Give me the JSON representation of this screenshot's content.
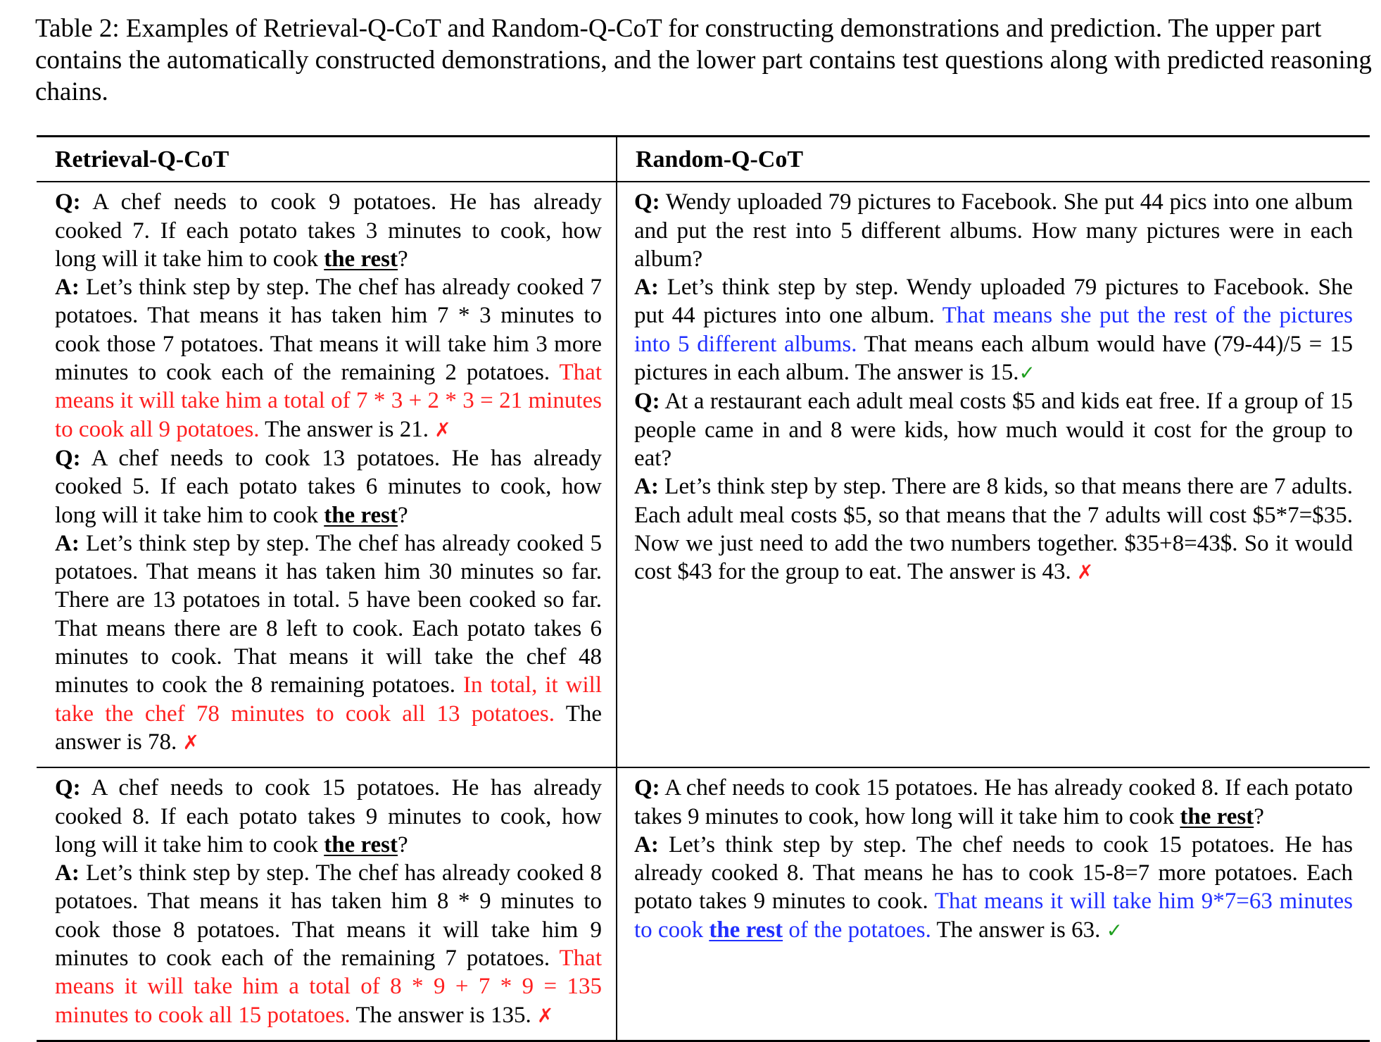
{
  "caption": "Table 2: Examples of Retrieval-Q-CoT and Random-Q-CoT for constructing demonstrations and prediction. The upper part contains the automatically constructed demonstrations, and the lower part contains test questions along with predicted reasoning chains.",
  "headers": {
    "left": "Retrieval-Q-CoT",
    "right": "Random-Q-CoT"
  },
  "colors": {
    "red": "#ff1f1f",
    "blue": "#1f2fff",
    "green": "#1f9f1f"
  },
  "rows": {
    "demo_left": [
      {
        "t": "Q:",
        "s": "q"
      },
      {
        "t": " A chef needs to cook 9 potatoes. He has already cooked 7. If each potato takes 3 minutes to cook, how long will it take him to cook ",
        "s": "n"
      },
      {
        "t": "the rest",
        "s": "ul"
      },
      {
        "t": "?",
        "s": "n"
      },
      {
        "t": "",
        "s": "br"
      },
      {
        "t": "A:",
        "s": "a"
      },
      {
        "t": " Let’s think step by step. The chef has already cooked 7 potatoes. That means it has taken him 7 * 3 minutes to cook those 7 potatoes. That means it will take him 3 more minutes to cook each of the remaining 2 potatoes. ",
        "s": "n"
      },
      {
        "t": "That means it will take him a total of 7 * 3 + 2 * 3 = 21 minutes to cook all 9 potatoes.",
        "s": "red"
      },
      {
        "t": " The answer is 21. ",
        "s": "n"
      },
      {
        "t": "✗",
        "s": "x"
      },
      {
        "t": "",
        "s": "br"
      },
      {
        "t": "Q:",
        "s": "q"
      },
      {
        "t": " A chef needs to cook 13 potatoes. He has already cooked 5. If each potato takes 6 minutes to cook, how long will it take him to cook ",
        "s": "n"
      },
      {
        "t": "the rest",
        "s": "ul"
      },
      {
        "t": "?",
        "s": "n"
      },
      {
        "t": "",
        "s": "br"
      },
      {
        "t": "A:",
        "s": "a"
      },
      {
        "t": " Let’s think step by step. The chef has already cooked 5 potatoes. That means it has taken him 30 minutes so far. There are 13 potatoes in total. 5 have been cooked so far. That means there are 8 left to cook. Each potato takes 6 minutes to cook. That means it will take the chef 48 minutes to cook the 8 remaining potatoes. ",
        "s": "n"
      },
      {
        "t": "In total, it will take the chef 78 minutes to cook all 13 potatoes.",
        "s": "red"
      },
      {
        "t": " The answer is 78. ",
        "s": "n"
      },
      {
        "t": "✗",
        "s": "x"
      }
    ],
    "demo_right": [
      {
        "t": "Q:",
        "s": "q"
      },
      {
        "t": " Wendy uploaded 79 pictures to Facebook. She put 44 pics into one album and put the rest into 5 different albums. How many pictures were in each album?",
        "s": "n"
      },
      {
        "t": "",
        "s": "br"
      },
      {
        "t": "A:",
        "s": "a"
      },
      {
        "t": " Let’s think step by step. Wendy uploaded 79 pictures to Facebook. She put 44 pictures into one album. ",
        "s": "n"
      },
      {
        "t": "That means she put the rest of the pictures into 5 different albums.",
        "s": "blue"
      },
      {
        "t": " That means each album would have (79-44)/5 = 15 pictures in each album. The answer is 15.",
        "s": "n"
      },
      {
        "t": "✓",
        "s": "check"
      },
      {
        "t": "",
        "s": "br"
      },
      {
        "t": "Q:",
        "s": "q"
      },
      {
        "t": " At a restaurant each adult meal costs $5 and kids eat free. If a group of 15 people came in and 8 were kids, how much would it cost for the group to eat?",
        "s": "n"
      },
      {
        "t": "",
        "s": "br"
      },
      {
        "t": "A:",
        "s": "a"
      },
      {
        "t": " Let’s think step by step. There are 8 kids, so that means there are 7 adults. Each adult meal costs $5, so that means that the 7 adults will cost $5*7=$35. Now we just need to add the two numbers together. $35+8=43$. So it would cost $43 for the group to eat. The answer is 43. ",
        "s": "n"
      },
      {
        "t": "✗",
        "s": "x"
      }
    ],
    "test_left": [
      {
        "t": "Q:",
        "s": "q"
      },
      {
        "t": " A chef needs to cook 15 potatoes. He has already cooked 8. If each potato takes 9 minutes to cook, how long will it take him to cook ",
        "s": "n"
      },
      {
        "t": "the rest",
        "s": "ul"
      },
      {
        "t": "?",
        "s": "n"
      },
      {
        "t": "",
        "s": "br"
      },
      {
        "t": "A:",
        "s": "a"
      },
      {
        "t": " Let’s think step by step. The chef has already cooked 8 potatoes. That means it has taken him 8 * 9 minutes to cook those 8 potatoes. That means it will take him 9 minutes to cook each of the remaining 7 potatoes. ",
        "s": "n"
      },
      {
        "t": "That means it will take him a total of 8 * 9 + 7 * 9 = 135 minutes to cook all 15 potatoes.",
        "s": "red"
      },
      {
        "t": " The answer is 135. ",
        "s": "n"
      },
      {
        "t": "✗",
        "s": "x"
      }
    ],
    "test_right": [
      {
        "t": "Q:",
        "s": "q"
      },
      {
        "t": " A chef needs to cook 15 potatoes. He has already cooked 8. If each potato takes 9 minutes to cook, how long will it take him to cook ",
        "s": "n"
      },
      {
        "t": "the rest",
        "s": "ul"
      },
      {
        "t": "?",
        "s": "n"
      },
      {
        "t": "",
        "s": "br"
      },
      {
        "t": "A:",
        "s": "a"
      },
      {
        "t": " Let’s think step by step. The chef needs to cook 15 potatoes. He has already cooked 8. That means he has to cook 15-8=7 more potatoes. Each potato takes 9 minutes to cook. ",
        "s": "n"
      },
      {
        "t": "That means it will take him 9*7=63 minutes to cook ",
        "s": "blue"
      },
      {
        "t": "the rest",
        "s": "blue-ul"
      },
      {
        "t": " of the potatoes.",
        "s": "blue"
      },
      {
        "t": " The answer is 63. ",
        "s": "n"
      },
      {
        "t": "✓",
        "s": "check"
      }
    ]
  }
}
